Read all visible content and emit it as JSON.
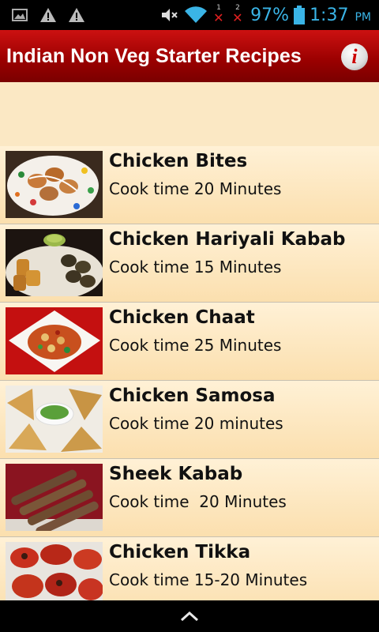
{
  "status_bar": {
    "sim1_label": "1",
    "sim2_label": "2",
    "battery": "97%",
    "time": "1:37",
    "ampm": "PM",
    "accent_color": "#3ab4e6"
  },
  "app_bar": {
    "title": "Indian Non Veg Starter Recipes",
    "info_icon": "info-icon",
    "info_label": "i"
  },
  "recipes": [
    {
      "name": "Chicken Bites",
      "time": "Cook time 20 Minutes"
    },
    {
      "name": "Chicken Hariyali Kabab",
      "time": "Cook time 15 Minutes"
    },
    {
      "name": "Chicken Chaat",
      "time": "Cook time 25 Minutes"
    },
    {
      "name": "Chicken Samosa",
      "time": "Cook time 20 minutes"
    },
    {
      "name": "Sheek Kabab",
      "time": "Cook time  20 Minutes"
    },
    {
      "name": "Chicken Tikka",
      "time": "Cook time 15-20 Minutes"
    }
  ],
  "colors": {
    "app_bar": "#b00000",
    "list_background": "#fbe8c4"
  }
}
